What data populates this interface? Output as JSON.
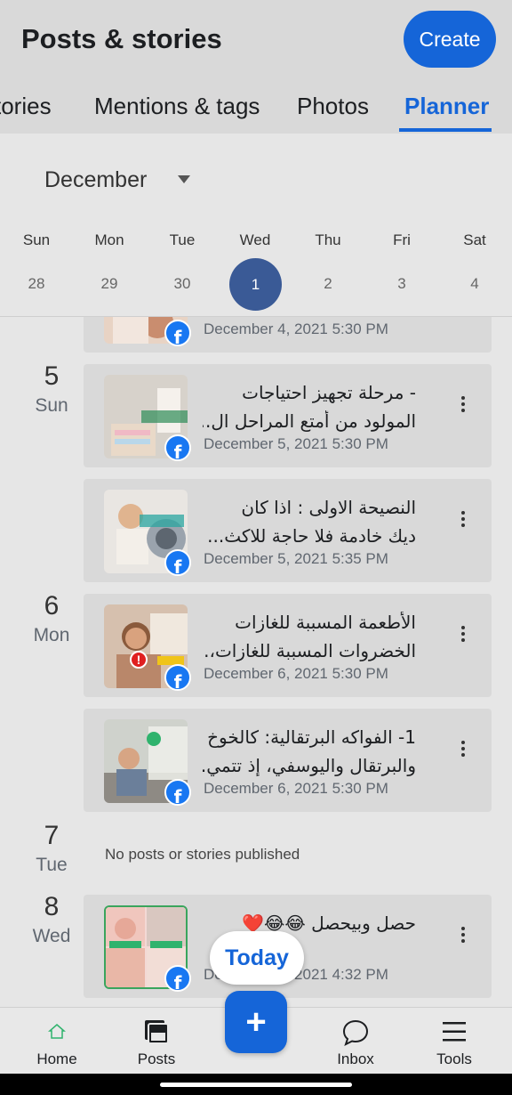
{
  "header": {
    "title": "Posts & stories",
    "create_label": "Create",
    "tabs": [
      {
        "label": "tories"
      },
      {
        "label": "Mentions & tags"
      },
      {
        "label": "Photos"
      },
      {
        "label": "Planner",
        "active": true
      }
    ]
  },
  "calendar": {
    "month": "December",
    "weekdays": [
      "Sun",
      "Mon",
      "Tue",
      "Wed",
      "Thu",
      "Fri",
      "Sat"
    ],
    "dates": [
      "28",
      "29",
      "30",
      "1",
      "2",
      "3",
      "4"
    ],
    "selected_date": "1"
  },
  "feed": {
    "days": [
      {
        "num": "5",
        "name": "Sun"
      },
      {
        "num": "6",
        "name": "Mon"
      },
      {
        "num": "7",
        "name": "Tue"
      },
      {
        "num": "8",
        "name": "Wed"
      }
    ],
    "empty_text": "No posts or stories published",
    "posts": [
      {
        "title1": "",
        "title2": "",
        "date": "December 4, 2021 5:30 PM",
        "network": "facebook-icon"
      },
      {
        "title1": "- مرحلة تجهيز احتياجات",
        "title2": "المولود من أمتع المراحل ال...",
        "date": "December 5, 2021 5:30 PM",
        "network": "facebook-icon"
      },
      {
        "title1": "النصيحة الاولى : اذا كان",
        "title2": "ديك خادمة فلا حاجة للاكث...",
        "date": "December 5, 2021 5:35 PM",
        "network": "facebook-icon"
      },
      {
        "title1": "الأطعمة المسببة للغازات",
        "title2": "الخضروات المسببة للغازات،...",
        "date": "December 6, 2021 5:30 PM",
        "network": "facebook-icon",
        "error": "!"
      },
      {
        "title1": "1- الفواكه البرتقالية: كالخوخ",
        "title2": "والبرتقال واليوسفي، إذ تتمي...",
        "date": "December 6, 2021 5:30 PM",
        "network": "facebook-icon"
      },
      {
        "title1": "حصل وبيحصل 😂😂❤️",
        "title2": "",
        "date": "December 8, 2021 4:32 PM",
        "network": "facebook-icon"
      }
    ]
  },
  "today_label": "Today",
  "bottom_nav": {
    "items": [
      {
        "label": "Home",
        "icon": "home-logo-icon"
      },
      {
        "label": "Posts",
        "icon": "posts-icon"
      },
      {
        "label": "Inbox",
        "icon": "chat-bubble-icon"
      },
      {
        "label": "Tools",
        "icon": "menu-icon"
      }
    ],
    "fab_label": "+"
  },
  "colors": {
    "accent": "#1565d8",
    "selected_date": "#3a5a96",
    "facebook": "#1877f2",
    "background": "#e6e6e6",
    "card": "#d9d9d9"
  }
}
